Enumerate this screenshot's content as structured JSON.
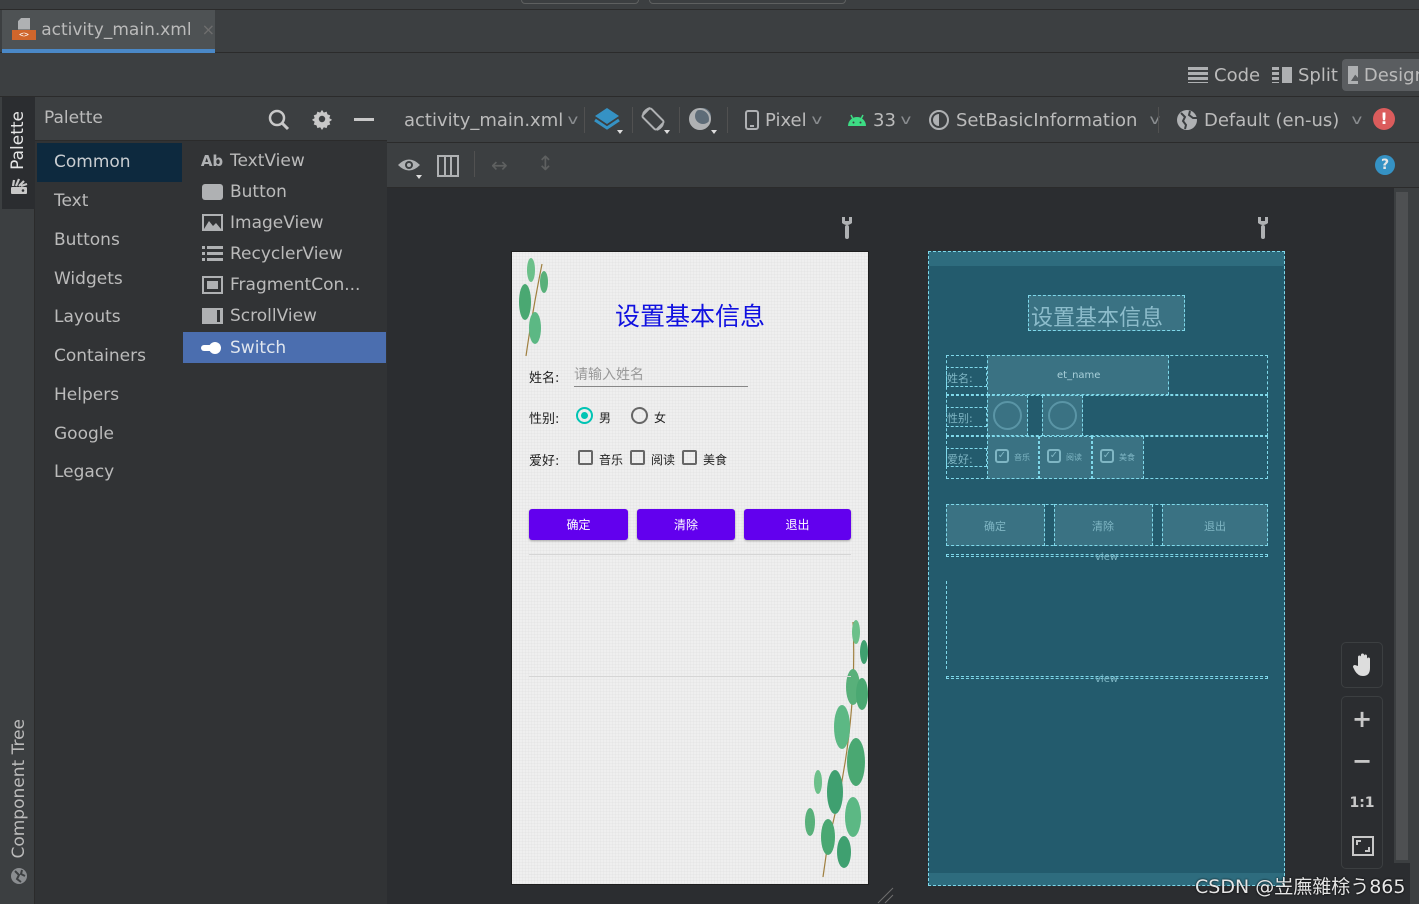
{
  "editor_tab": {
    "file_name": "activity_main.xml",
    "close": "×"
  },
  "view_modes": [
    {
      "label": "Code",
      "icon": "code-lines-icon"
    },
    {
      "label": "Split",
      "icon": "split-icon"
    },
    {
      "label": "Design",
      "icon": "design-icon",
      "active": true
    }
  ],
  "side_tabs": {
    "palette": "Palette",
    "component_tree": "Component Tree"
  },
  "palette": {
    "title": "Palette",
    "categories": [
      "Common",
      "Text",
      "Buttons",
      "Widgets",
      "Layouts",
      "Containers",
      "Helpers",
      "Google",
      "Legacy"
    ],
    "selected_category": "Common",
    "components": [
      {
        "icon": "Ab",
        "label": "TextView"
      },
      {
        "icon": "button-icon",
        "label": "Button"
      },
      {
        "icon": "imageview-icon",
        "label": "ImageView"
      },
      {
        "icon": "recyclerview-icon",
        "label": "RecyclerView"
      },
      {
        "icon": "fragment-icon",
        "label": "FragmentCon..."
      },
      {
        "icon": "scrollview-icon",
        "label": "ScrollView"
      },
      {
        "icon": "switch-icon",
        "label": "Switch"
      }
    ],
    "selected_component": "Switch"
  },
  "design_toolbar": {
    "file": "activity_main.xml",
    "device": "Pixel",
    "api_level": "33",
    "theme": "SetBasicInformation",
    "locale": "Default (en-us)"
  },
  "design_preview": {
    "title": "设置基本信息",
    "name_label": "姓名:",
    "name_placeholder": "请输入姓名",
    "gender_label": "性别:",
    "gender_options": [
      {
        "label": "男",
        "checked": true
      },
      {
        "label": "女",
        "checked": false
      }
    ],
    "hobby_label": "爱好:",
    "hobbies": [
      {
        "label": "音乐",
        "checked": false
      },
      {
        "label": "阅读",
        "checked": false
      },
      {
        "label": "美食",
        "checked": false
      }
    ],
    "buttons": [
      "确定",
      "清除",
      "退出"
    ],
    "button_color": "#6200ee",
    "title_color": "#1010e0"
  },
  "blueprint": {
    "title": "设置基本信息",
    "name_label": "姓名:",
    "name_field_id": "et_name",
    "gender_label": "性别:",
    "hobby_label": "爱好:",
    "hobbies": [
      "音乐",
      "阅读",
      "美食"
    ],
    "buttons": [
      "确定",
      "清除",
      "退出"
    ],
    "view_label": "view"
  },
  "zoom_controls": {
    "plus": "+",
    "minus": "−",
    "actual": "1:1"
  },
  "watermark": "CSDN @岦廡雜梌う865"
}
